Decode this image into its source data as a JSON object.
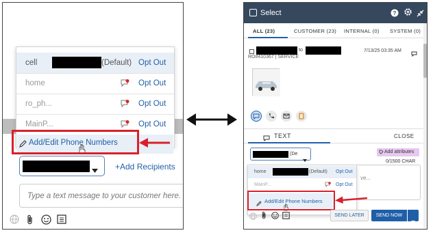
{
  "left": {
    "options": [
      {
        "name": "cell",
        "suffix": "(Default)",
        "opt_out": "Opt Out"
      },
      {
        "name": "home",
        "opt_out": "Opt Out"
      },
      {
        "name": "ro_ph...",
        "opt_out": "Opt Out"
      },
      {
        "name": "MainP...",
        "opt_out": "Opt Out"
      }
    ],
    "add_edit_label": "Add/Edit Phone Numbers",
    "add_recipients": "+Add Recipients",
    "message_placeholder": "Type a text message to your customer here."
  },
  "right": {
    "header": {
      "select_label": "Select",
      "icons": [
        "help-icon",
        "gear-icon",
        "collapse-icon"
      ]
    },
    "tabs": [
      "ALL (23)",
      "CUSTOMER (23)",
      "INTERNAL (0)",
      "SYSTEM (0)"
    ],
    "card": {
      "to_label": "to",
      "meta": "RO#410367 | SERVICE",
      "date": "7/13/25 03:35 AM"
    },
    "text_tab": "TEXT",
    "close_label": "CLOSE",
    "recipient_suffix": "(De",
    "add_attributes": "Add attributes",
    "char_count": "0/1500 CHAR",
    "options": [
      {
        "name": "home",
        "suffix": "(Default)",
        "opt_out": "Opt Out"
      },
      {
        "name": "MainP...",
        "opt_out": "Opt Out"
      }
    ],
    "add_edit_label": "Add/Edit Phone Numbers",
    "message_fragment": "ve...",
    "send_later": "SEND LATER",
    "send_now": "SEND NOW"
  },
  "colors": {
    "accent": "#1f5fa8",
    "highlight": "#d9202a",
    "header": "#35485d"
  }
}
